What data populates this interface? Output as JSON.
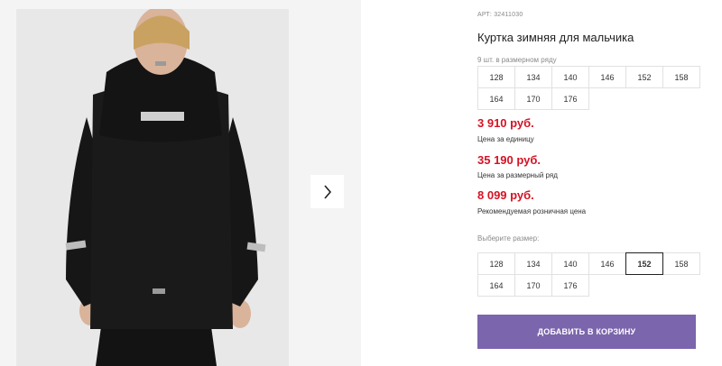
{
  "product": {
    "sku": "АРТ: 32411030",
    "title": "Куртка зимняя для мальчика",
    "sizes_note": "9 шт. в размерном ряду",
    "size_row": [
      "128",
      "134",
      "140",
      "146",
      "152",
      "158",
      "164",
      "170",
      "176"
    ]
  },
  "prices": [
    {
      "value": "3 910 руб.",
      "label": "Цена за единицу"
    },
    {
      "value": "35 190 руб.",
      "label": "Цена за размерный ряд"
    },
    {
      "value": "8 099 руб.",
      "label": "Рекомендуемая розничная цена"
    }
  ],
  "size_picker": {
    "label": "Выберите размер:",
    "options": [
      "128",
      "134",
      "140",
      "146",
      "152",
      "158",
      "164",
      "170",
      "176"
    ],
    "selected": "152"
  },
  "cart": {
    "add_label": "ДОБАВИТЬ В КОРЗИНУ"
  },
  "gallery": {
    "next_icon": "chevron-right-icon"
  },
  "colors": {
    "price": "#d51224",
    "button": "#7b65ac"
  }
}
